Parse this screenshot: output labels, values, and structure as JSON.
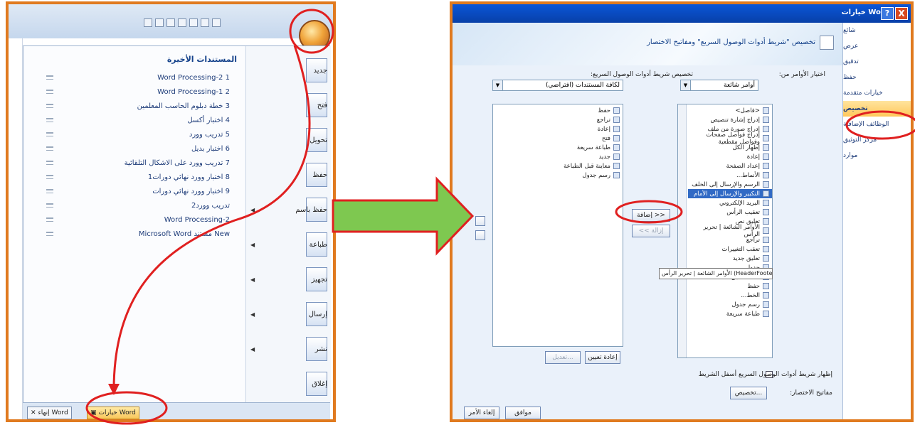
{
  "left_panel": {
    "qat_icons": [
      "save-icon",
      "undo-icon",
      "redo-icon",
      "print-icon",
      "new-icon",
      "open-icon",
      "email-icon"
    ],
    "recent_title": "المستندات الأخيرة",
    "recent": [
      {
        "num": "1",
        "name": "Word Processing-2"
      },
      {
        "num": "2",
        "name": "Word Processing-1"
      },
      {
        "num": "3",
        "name": "خطة دبلوم الحاسب المعلمين"
      },
      {
        "num": "4",
        "name": "اختبار أكسل"
      },
      {
        "num": "5",
        "name": "تدريب وورد"
      },
      {
        "num": "6",
        "name": "اختبار بديل"
      },
      {
        "num": "7",
        "name": "تدريب وورد على الاشكال التلقائية"
      },
      {
        "num": "8",
        "name": "اختبار وورد نهائي دورات1"
      },
      {
        "num": "9",
        "name": "اختبار وورد نهائي دورات"
      },
      {
        "num": "",
        "name": "تدريب وورد2"
      },
      {
        "num": "",
        "name": "Word Processing-2"
      },
      {
        "num": "",
        "name": "New مستند Microsoft Word"
      }
    ],
    "commands": [
      {
        "label": "جديد",
        "arrow": false
      },
      {
        "label": "فتح",
        "arrow": false
      },
      {
        "label": "تحويل",
        "arrow": false
      },
      {
        "label": "حفظ",
        "arrow": false
      },
      {
        "label": "حفظ باسم",
        "arrow": true
      },
      {
        "label": "طباعة",
        "arrow": true
      },
      {
        "label": "تجهيز",
        "arrow": true
      },
      {
        "label": "إرسال",
        "arrow": true
      },
      {
        "label": "نشر",
        "arrow": true
      },
      {
        "label": "إغلاق",
        "arrow": false
      }
    ],
    "footer_options": "خيارات Word",
    "footer_exit": "إنهاء Word"
  },
  "dialog": {
    "title": "خيارات Word",
    "help": "?",
    "close": "X",
    "nav": [
      "شائع",
      "عرض",
      "تدقيق",
      "حفظ",
      "خيارات متقدمة",
      "تخصيص",
      "الوظائف الإضافية",
      "مركز التوثيق",
      "موارد"
    ],
    "header_text": "تخصيص \"شريط أدوات الوصول السريع\" ومفاتيح الاختصار",
    "choose_label": "اختيار الأوامر من:",
    "choose_value": "أوامر شائعة",
    "customize_label": "تخصيص شريط أدوات الوصول السريع:",
    "customize_value": "لكافة المستندات (افتراضي)",
    "commands_list": [
      "<فاصل>",
      "إدراج إشارة تنصيص",
      "إدراج صورة من ملف",
      "إدراج فواصل صفحات وفواصل مقطعية",
      "إظهار الكل",
      "إعادة",
      "إعداد الصفحة",
      "الأنماط...",
      "الرسم والإرسال إلى الخلف",
      "التكبير والإرسال إلى الأمام",
      "البريد الإلكتروني",
      "تعقيب الرأس",
      "تعليق نص",
      "الأوامر الشائعة | تحرير الرأس",
      "تراجع",
      "تعقب التغييرات",
      "تعليق جديد",
      "جدول",
      "حذف تعليق...",
      "حفظ",
      "الخط...",
      "رسم جدول",
      "طباعة سريعة"
    ],
    "qat_list": [
      "حفظ",
      "تراجع",
      "إعادة",
      "فتح",
      "طباعة سريعة",
      "جديد",
      "معاينة قبل الطباعة",
      "رسم جدول"
    ],
    "add_button": "إضافة >>",
    "remove_button": "<< إزالة",
    "tooltip": "الأوامر الشائعة | تحرير الرأس (HeaderFooterEditHeader)",
    "reset_button": "إعادة تعيين",
    "modify_button": "تعديل...",
    "show_below_label": "إظهار شريط أدوات الوصول السريع أسفل الشريط",
    "shortcuts_label": "مفاتيح الاختصار:",
    "shortcuts_button": "تخصيص...",
    "ok_button": "موافق",
    "cancel_button": "إلغاء الأمر"
  },
  "colors": {
    "frame": "#e07a1f",
    "arrow": "#7ec850",
    "annotation": "#e02020",
    "titlebar": "#0a56d8"
  }
}
